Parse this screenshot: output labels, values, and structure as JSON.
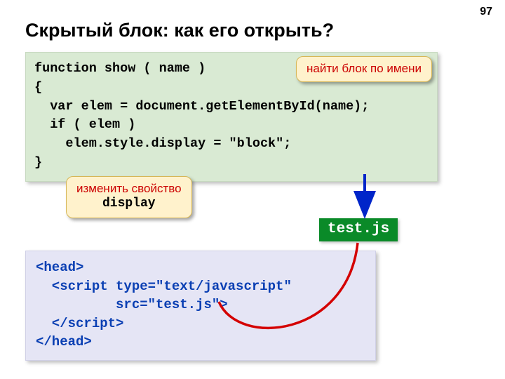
{
  "page_number": "97",
  "title": "Скрытый блок: как его открыть?",
  "code_green": "function show ( name )\n{\n  var elem = document.getElementById(name);\n  if ( elem )\n    elem.style.display = \"block\";\n}",
  "callout_find": "найти блок по имени",
  "callout_display_top": "изменить свойство",
  "callout_display_mono": "display",
  "file_badge": "test.js",
  "code_lav": "<head>\n  <script type=\"text/javascript\"\n          src=\"test.js\">\n  </script>\n</head>"
}
